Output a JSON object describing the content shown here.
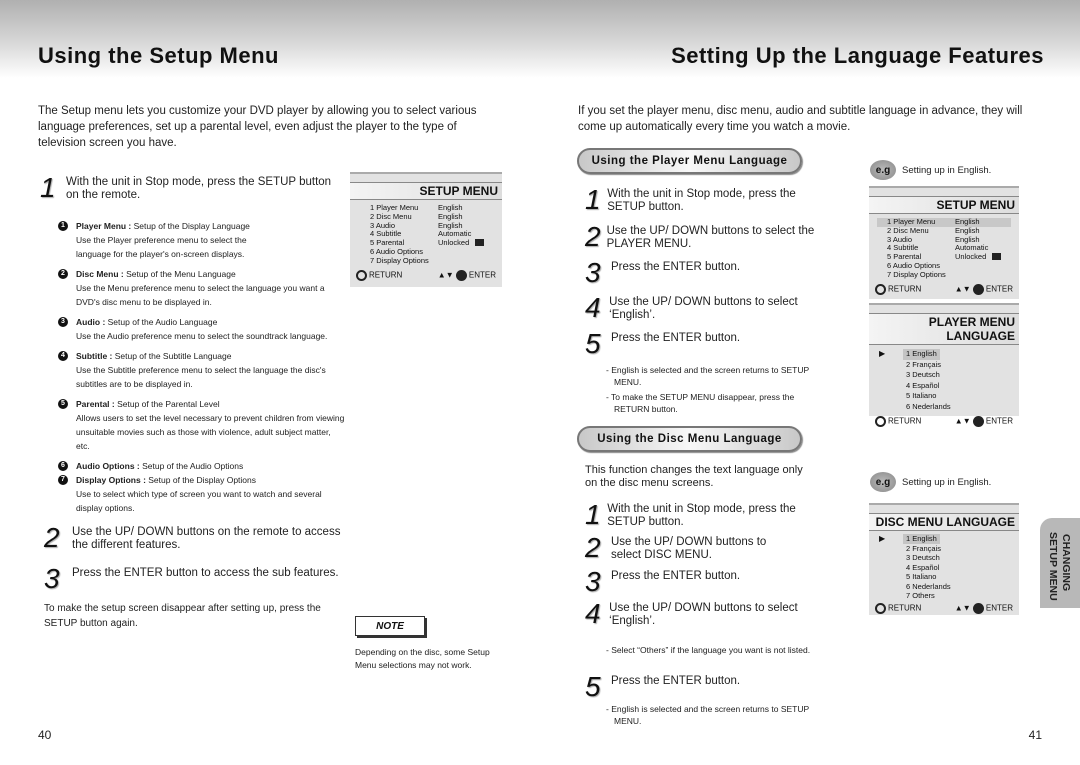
{
  "left": {
    "title": "Using the Setup Menu",
    "intro": "The Setup menu lets you customize your DVD player by allowing you to select various language preferences, set up a parental level, even adjust the player to the type of television screen you have.",
    "step1": {
      "num": "1",
      "text": "With the unit in Stop mode, press the SETUP button on the remote."
    },
    "features": [
      {
        "num": "1",
        "name": "Player Menu :",
        "summary": " Setup of the Display Language",
        "desc": "Use the Player preference menu to select the language for the player's on-screen displays."
      },
      {
        "num": "2",
        "name": "Disc Menu :",
        "summary": " Setup of the Menu Language",
        "desc": "Use the Menu preference menu to select the language you want a DVD's disc menu to be displayed in."
      },
      {
        "num": "3",
        "name": "Audio :",
        "summary": " Setup of the Audio Language",
        "desc": "Use the Audio preference menu to select the soundtrack language."
      },
      {
        "num": "4",
        "name": "Subtitle :",
        "summary": " Setup of the Subtitle Language",
        "desc": "Use the Subtitle preference menu to select the language the disc's subtitles are to be displayed in."
      },
      {
        "num": "5",
        "name": "Parental :",
        "summary": " Setup of the Parental Level",
        "desc": "Allows users to set the level necessary to prevent children from viewing unsuitable movies such as those with violence, adult subject matter, etc."
      },
      {
        "num": "6",
        "name": "Audio Options :",
        "summary": " Setup of the Audio Options",
        "desc": ""
      },
      {
        "num": "7",
        "name": "Display Options :",
        "summary": " Setup of the Display Options",
        "desc": "Use to select which type of screen you want to watch and several display options."
      }
    ],
    "step2": {
      "num": "2",
      "text": "Use the UP/ DOWN buttons on the remote to access the different features."
    },
    "step3": {
      "num": "3",
      "text": "Press the ENTER button to access the sub features."
    },
    "closing": "To make the setup screen disappear after setting up, press the SETUP button again.",
    "note": {
      "label": "NOTE",
      "text": "Depending on the disc, some Setup Menu selections may not work."
    },
    "page_number": "40"
  },
  "setup_menu": {
    "title": "SETUP MENU",
    "rows": [
      {
        "key": "1  Player Menu",
        "value": "English"
      },
      {
        "key": "2  Disc Menu",
        "value": "English"
      },
      {
        "key": "3  Audio",
        "value": "English"
      },
      {
        "key": "4  Subtitle",
        "value": "Automatic"
      },
      {
        "key": "5  Parental",
        "value": "Unlocked"
      },
      {
        "key": "6  Audio Options",
        "value": ""
      },
      {
        "key": "7  Display Options",
        "value": ""
      }
    ],
    "return_label": "RETURN",
    "enter_label": "ENTER",
    "nav_glyph": "▲▼"
  },
  "right": {
    "title": "Setting Up the Language Features",
    "intro": "If you set the player menu, disc menu, audio and subtitle language in advance, they will come up automatically every time you watch a movie.",
    "player_section": {
      "heading": "Using the Player Menu Language",
      "steps": [
        {
          "num": "1",
          "text": "With the unit in Stop mode, press the SETUP button."
        },
        {
          "num": "2",
          "text": "Use the UP/ DOWN buttons to select the PLAYER MENU."
        },
        {
          "num": "3",
          "text": "Press the ENTER button."
        },
        {
          "num": "4",
          "text": "Use the UP/ DOWN buttons to select ‘English’."
        },
        {
          "num": "5",
          "text": "Press the ENTER button."
        }
      ],
      "notes": [
        "- English is selected and the screen returns to SETUP MENU.",
        "- To make the SETUP MENU disappear, press the RETURN button."
      ],
      "eg_badge": "e.g",
      "eg_text": "Setting up in English."
    },
    "disc_section": {
      "heading": "Using the Disc Menu Language",
      "intro": "This function changes the text language only on the disc menu screens.",
      "steps": [
        {
          "num": "1",
          "text": "With the unit in Stop mode, press the SETUP button."
        },
        {
          "num": "2",
          "text": "Use the UP/ DOWN buttons to select DISC MENU."
        },
        {
          "num": "3",
          "text": "Press the ENTER button."
        },
        {
          "num": "4",
          "text": "Use the UP/ DOWN buttons to select ‘English’."
        },
        {
          "num": "5",
          "text": "Press the ENTER button."
        }
      ],
      "note4": "- Select “Others” if the language you want is not listed.",
      "note5": "- English is selected and the screen returns to SETUP MENU.",
      "eg_badge": "e.g",
      "eg_text": "Setting up in English."
    },
    "player_lang_menu": {
      "title": "PLAYER MENU LANGUAGE",
      "items": [
        "1  English",
        "2  Français",
        "3  Deutsch",
        "4  Español",
        "5  Italiano",
        "6  Nederlands"
      ],
      "selected_index": 0
    },
    "disc_lang_menu": {
      "title": "DISC MENU LANGUAGE",
      "items": [
        "1  English",
        "2  Français",
        "3  Deutsch",
        "4  Español",
        "5  Italiano",
        "6  Nederlands",
        "7 Others"
      ],
      "selected_index": 0
    },
    "side_tab": {
      "line1": "CHANGING",
      "line2": "SETUP MENU"
    },
    "page_number": "41"
  }
}
